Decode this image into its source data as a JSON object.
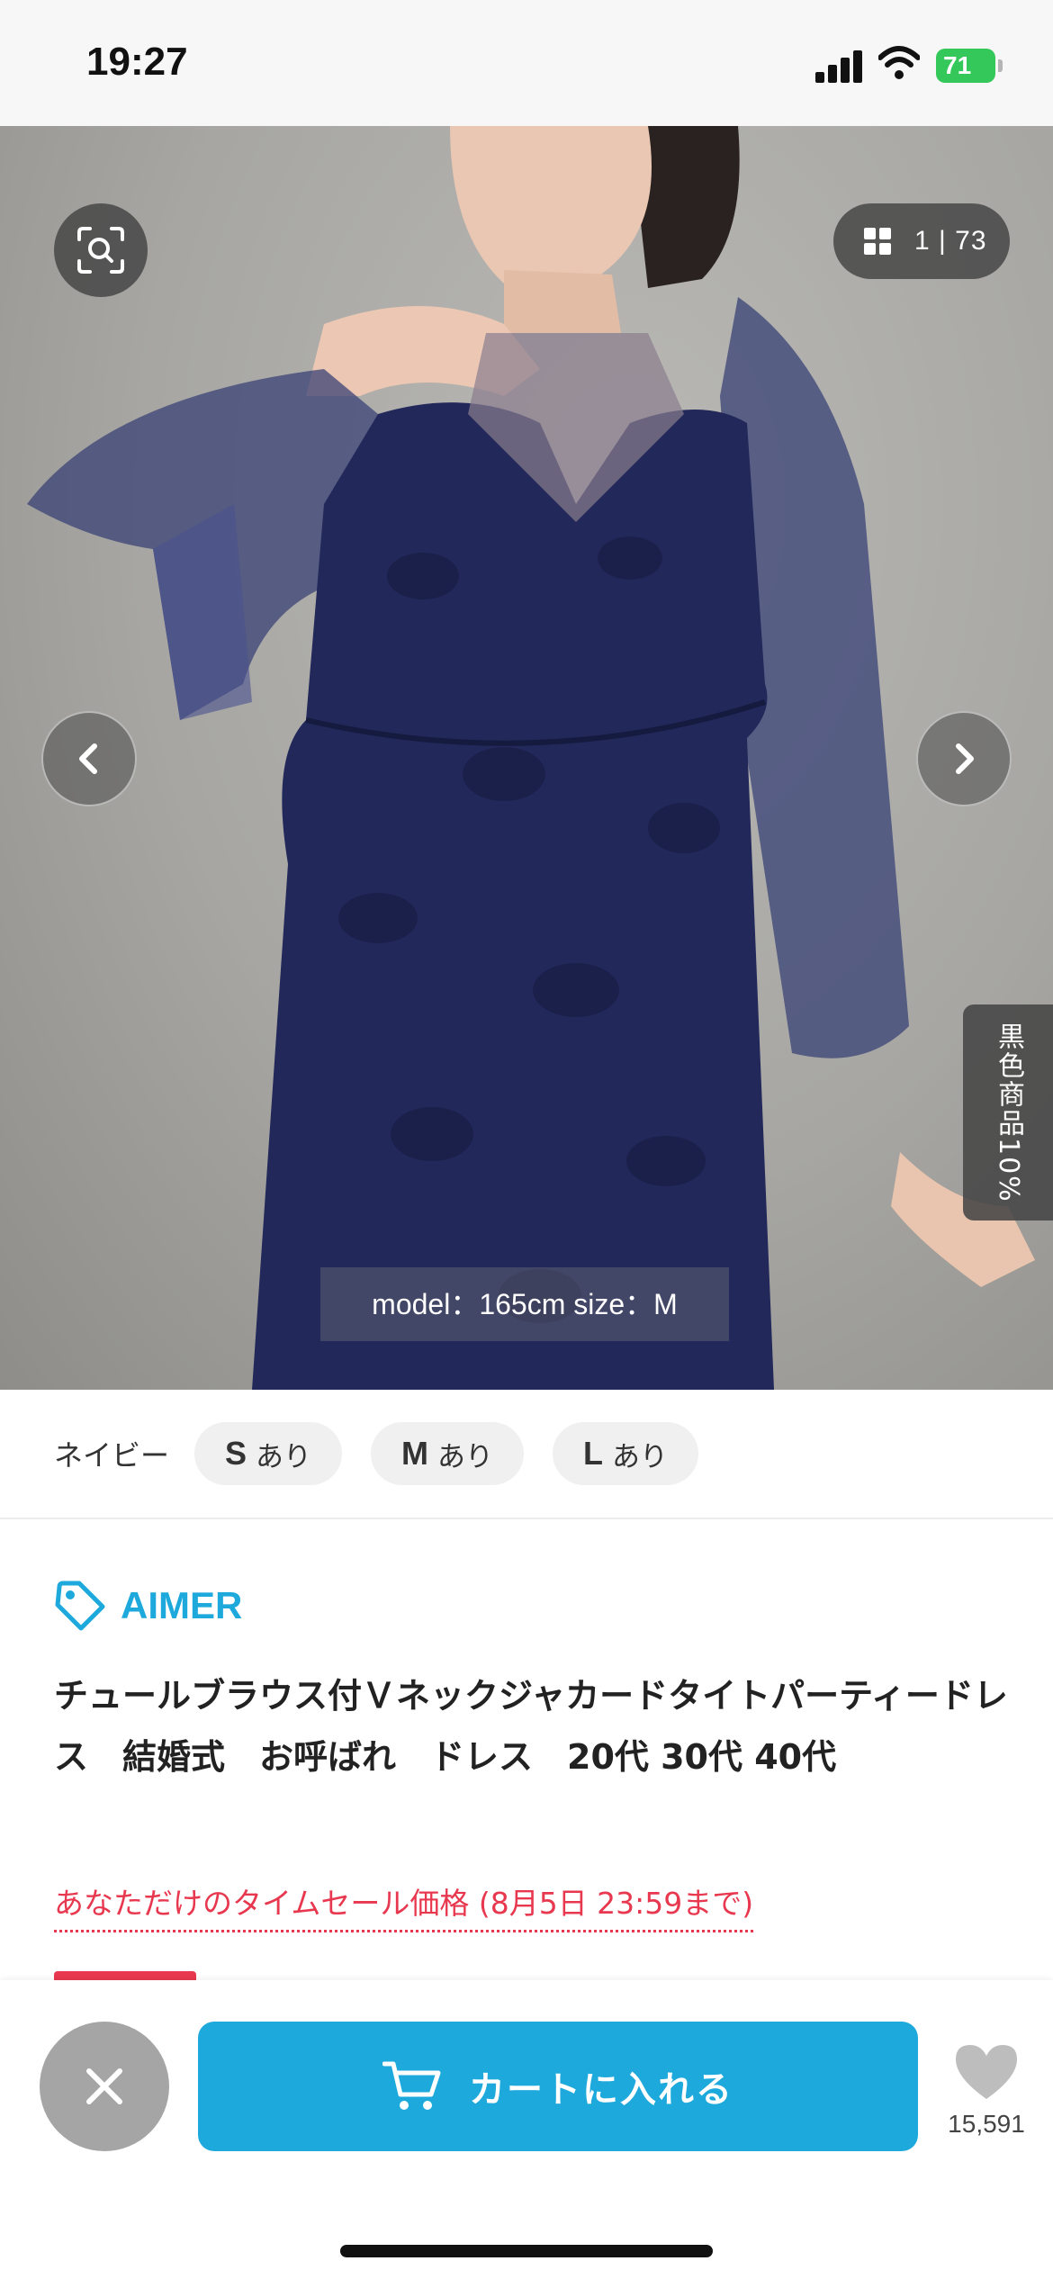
{
  "status_bar": {
    "time": "19:27",
    "battery_level": "71",
    "icons": [
      "signal-icon",
      "wifi-icon",
      "battery-icon"
    ]
  },
  "gallery": {
    "counter": "1 | 73",
    "model_caption": "model：165cm size：M",
    "side_badge": "黒色商品10%",
    "icons": [
      "zoom-search-icon",
      "grid-icon",
      "chevron-left-icon",
      "chevron-right-icon"
    ]
  },
  "variation": {
    "color": "ネイビー",
    "sizes": [
      {
        "size": "S",
        "stock": "あり"
      },
      {
        "size": "M",
        "stock": "あり"
      },
      {
        "size": "L",
        "stock": "あり"
      }
    ]
  },
  "product": {
    "brand": "AIMER",
    "title": "チュールブラウス付ＶネックジャカードタイトパーティードレスΆ結婚式Άお呼ばれΆドレスΆ20代 30代 40代",
    "sale_notice": "あなただけのタイムセール価格 (8月5日 23:59まで)"
  },
  "actions": {
    "cart_label": "カートに入れる",
    "favorite_count": "15,591",
    "icons": [
      "close-icon",
      "cart-icon",
      "heart-icon"
    ]
  },
  "colors": {
    "brand_blue": "#1ea9dc",
    "sale_red": "#e8384f",
    "battery_green": "#34c759"
  }
}
